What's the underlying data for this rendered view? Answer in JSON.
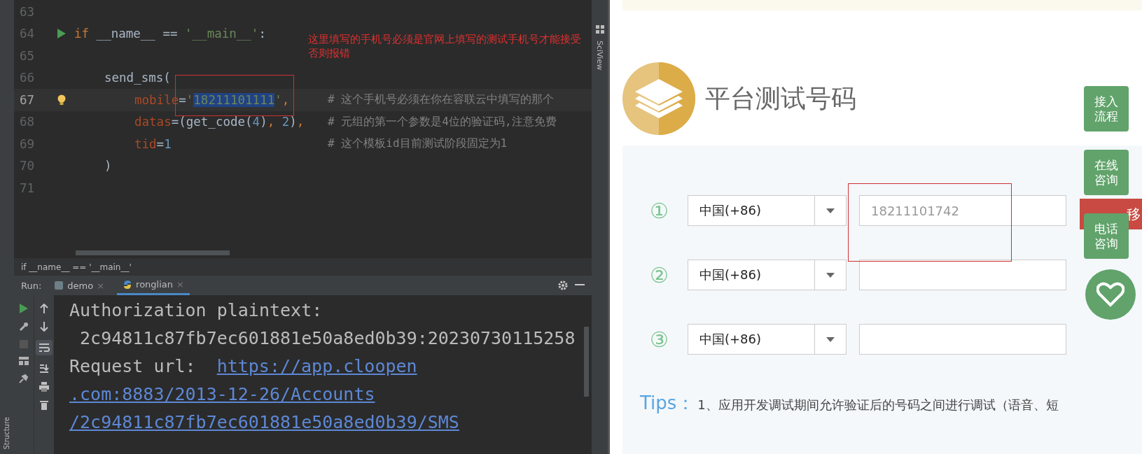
{
  "editor": {
    "lines": [
      {
        "number": "63",
        "current": false
      },
      {
        "number": "64",
        "current": false,
        "runnable": true,
        "tokens": [
          {
            "t": "if",
            "kind": "keyword"
          },
          {
            "t": " __name__ == ",
            "kind": "plain"
          },
          {
            "t": "'__main__'",
            "kind": "string"
          },
          {
            "t": ":",
            "kind": "plain"
          }
        ],
        "children": [
          {
            "number": "65",
            "current": false
          },
          {
            "number": "66",
            "current": false,
            "tokens": [
              {
                "t": "send_sms(",
                "kind": "plain"
              }
            ],
            "children": [
              {
                "number": "67",
                "current": true,
                "hint": true,
                "tokens": [
                  {
                    "t": "mobile",
                    "kind": "param"
                  },
                  {
                    "t": "=",
                    "kind": "plain"
                  },
                  {
                    "t": "'",
                    "kind": "string"
                  },
                  {
                    "t": "18211101111",
                    "kind": "selected"
                  },
                  {
                    "t": "'",
                    "kind": "string"
                  },
                  {
                    "t": ",",
                    "kind": "keyword"
                  }
                ],
                "comment": "# 这个手机号必须在你在容联云中填写的那个"
              },
              {
                "number": "68",
                "current": false,
                "tokens": [
                  {
                    "t": "datas",
                    "kind": "param"
                  },
                  {
                    "t": "=(get_code(",
                    "kind": "plain"
                  },
                  {
                    "t": "4",
                    "kind": "number"
                  },
                  {
                    "t": ")",
                    "kind": "plain"
                  },
                  {
                    "t": ", ",
                    "kind": "keyword"
                  },
                  {
                    "t": "2",
                    "kind": "number"
                  },
                  {
                    "t": ")",
                    "kind": "plain"
                  },
                  {
                    "t": ",",
                    "kind": "keyword"
                  }
                ],
                "comment": "# 元组的第一个参数是4位的验证码,注意免费"
              },
              {
                "number": "69",
                "current": false,
                "tokens": [
                  {
                    "t": "tid",
                    "kind": "param"
                  },
                  {
                    "t": "=",
                    "kind": "plain"
                  },
                  {
                    "t": "1",
                    "kind": "number"
                  }
                ],
                "comment": "# 这个模板id目前测试阶段固定为1"
              }
            ]
          },
          {
            "number": "70",
            "current": false,
            "tokens": [
              {
                "t": ")",
                "kind": "plain"
              }
            ]
          }
        ]
      },
      {
        "number": "71",
        "current": false
      }
    ],
    "annotation": [
      "这里填写的手机号必须是官网上填写的测试手机号才能接受",
      "否则报错"
    ]
  },
  "side_tool": "SciView",
  "left_tool": "Structure",
  "breadcrumb": "if __name__ == '__main__'",
  "run": {
    "label": "Run:",
    "tabs": [
      {
        "label": "demo",
        "close": "×",
        "selected": false
      },
      {
        "label": "ronglian",
        "close": "×",
        "selected": true
      }
    ]
  },
  "console": [
    {
      "text": "Authorization plaintext:",
      "kind": "text"
    },
    {
      "text": " 2c94811c87fb7ec601881e50a8ed0b39:20230730115258",
      "kind": "text"
    },
    {
      "text": "Request url:",
      "kind": "text"
    },
    {
      "text": "https://app.cloopen",
      "kind": "link"
    },
    {
      "text": ".com:8883/2013-12-26/Accounts",
      "kind": "link"
    },
    {
      "text": "/2c94811c87fb7ec601881e50a8ed0b39/SMS",
      "kind": "link"
    }
  ],
  "web": {
    "title": "平台测试号码",
    "rows": [
      {
        "number": "①",
        "country": "中国(+86)",
        "value": "18211101742"
      },
      {
        "number": "②",
        "country": "中国(+86)"
      },
      {
        "number": "③",
        "country": "中国(+86)"
      }
    ],
    "side_buttons": [
      "接入流程",
      "在线咨询",
      "电话咨询"
    ],
    "red_tab": "移",
    "tips": {
      "label": "Tips：",
      "text": "1、应用开发调试期间允许验证后的号码之间进行调试（语音、短"
    }
  }
}
